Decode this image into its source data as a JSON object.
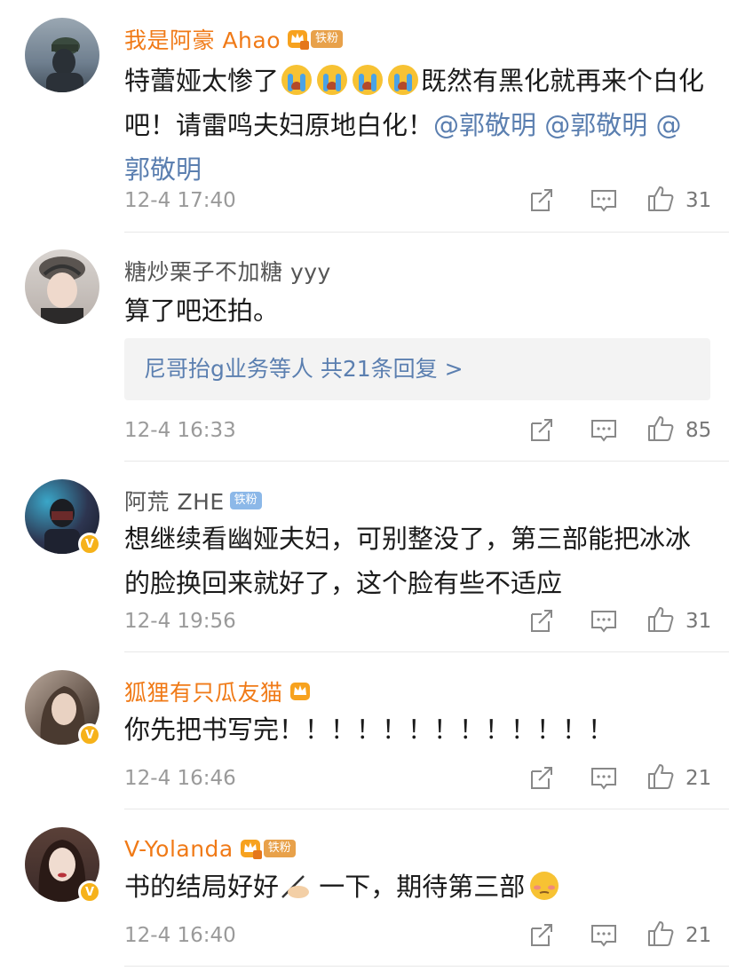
{
  "comments": [
    {
      "name": "我是阿豪 Ahao",
      "fan_badge": "铁粉",
      "text_parts": [
        "特蕾娅太惨了",
        "既然有黑化就再来个白化吧！请雷鸣夫妇原地白化！",
        "@郭敬明 @郭敬明 @郭敬明"
      ],
      "time": "12-4 17:40",
      "likes": "31",
      "colors": {
        "avatar": "#6f7f8f"
      }
    },
    {
      "name": "糖炒栗子不加糖 yyy",
      "text": "算了吧还拍。",
      "reply_preview": "尼哥抬g业务等人  共21条回复 >",
      "time": "12-4 16:33",
      "likes": "85",
      "colors": {
        "avatar": "#c9c3c0"
      }
    },
    {
      "name": "阿荒 ZHE",
      "fan_badge": "铁粉",
      "text": "想继续看幽娅夫妇，可别整没了，第三部能把冰冰的脸换回来就好了，这个脸有些不适应",
      "time": "12-4 19:56",
      "likes": "31",
      "colors": {
        "avatar": "#2d3550"
      }
    },
    {
      "name": "狐狸有只瓜友猫",
      "text": "你先把书写完！！！！！！！！！！！！！",
      "time": "12-4 16:46",
      "likes": "21",
      "colors": {
        "avatar": "#6a5a50"
      }
    },
    {
      "name": "V-Yolanda",
      "fan_badge": "铁粉",
      "text_parts": [
        "书的结局好好",
        " 一下，期待第三部"
      ],
      "time": "12-4 16:40",
      "likes": "21",
      "colors": {
        "avatar": "#3a2a28"
      }
    }
  ],
  "icons": [
    "share-icon",
    "comment-icon",
    "like-icon",
    "crown-icon",
    "verified-icon",
    "crying-emoji",
    "writing-hand-emoji",
    "shy-emoji"
  ],
  "colors": {
    "vip_name": "#f07a17",
    "link": "#5b7fb0",
    "timestamp": "#9a9a9a"
  }
}
